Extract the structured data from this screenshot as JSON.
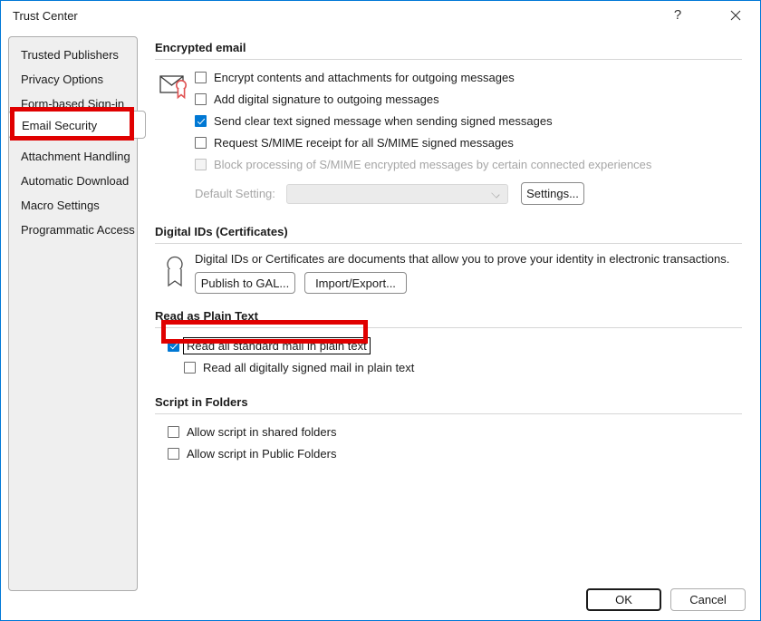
{
  "window": {
    "title": "Trust Center",
    "help_icon": "?",
    "close_icon": "close-icon"
  },
  "sidebar": {
    "items": [
      {
        "label": "Trusted Publishers",
        "selected": false
      },
      {
        "label": "Privacy Options",
        "selected": false
      },
      {
        "label": "Form-based Sign-in",
        "selected": false
      },
      {
        "label": "Email Security",
        "selected": true
      },
      {
        "label": "Attachment Handling",
        "selected": false
      },
      {
        "label": "Automatic Download",
        "selected": false
      },
      {
        "label": "Macro Settings",
        "selected": false
      },
      {
        "label": "Programmatic Access",
        "selected": false
      }
    ]
  },
  "highlights": {
    "color": "#e00000",
    "targets": [
      "Email Security",
      "Read all standard mail in plain text"
    ]
  },
  "sections": {
    "encrypted_email": {
      "title": "Encrypted email",
      "icon": "envelope-certificate-icon",
      "checkboxes": [
        {
          "label": "Encrypt contents and attachments for outgoing messages",
          "checked": false,
          "disabled": false,
          "accel": "E"
        },
        {
          "label": "Add digital signature to outgoing messages",
          "checked": false,
          "disabled": false,
          "accel": "d"
        },
        {
          "label": "Send clear text signed message when sending signed messages",
          "checked": true,
          "disabled": false,
          "accel": "t"
        },
        {
          "label": "Request S/MIME receipt for all S/MIME signed messages",
          "checked": false,
          "disabled": false,
          "accel": "R"
        },
        {
          "label": "Block processing of S/MIME encrypted messages by certain connected experiences",
          "checked": false,
          "disabled": true,
          "accel": ""
        }
      ],
      "default_setting_label": "Default Setting:",
      "default_setting_value": "",
      "default_setting_disabled": true,
      "settings_button": "Settings...",
      "settings_button_accel": "S"
    },
    "digital_ids": {
      "title": "Digital IDs (Certificates)",
      "icon": "certificate-ribbon-icon",
      "description": "Digital IDs or Certificates are documents that allow you to prove your identity in electronic transactions.",
      "buttons": [
        {
          "label": "Publish to GAL...",
          "accel": "P"
        },
        {
          "label": "Import/Export...",
          "accel": "I"
        }
      ]
    },
    "read_as_plain_text": {
      "title": "Read as Plain Text",
      "checkboxes": [
        {
          "label": "Read all standard mail in plain text",
          "checked": true,
          "focused": true,
          "accel": "a"
        },
        {
          "label": "Read all digitally signed mail in plain text",
          "checked": false,
          "focused": false,
          "accel": "m"
        }
      ]
    },
    "script_in_folders": {
      "title": "Script in Folders",
      "checkboxes": [
        {
          "label": "Allow script in shared folders",
          "checked": false,
          "accel": "l"
        },
        {
          "label": "Allow script in Public Folders",
          "checked": false,
          "accel": "F"
        }
      ]
    }
  },
  "footer": {
    "ok_label": "OK",
    "cancel_label": "Cancel"
  }
}
